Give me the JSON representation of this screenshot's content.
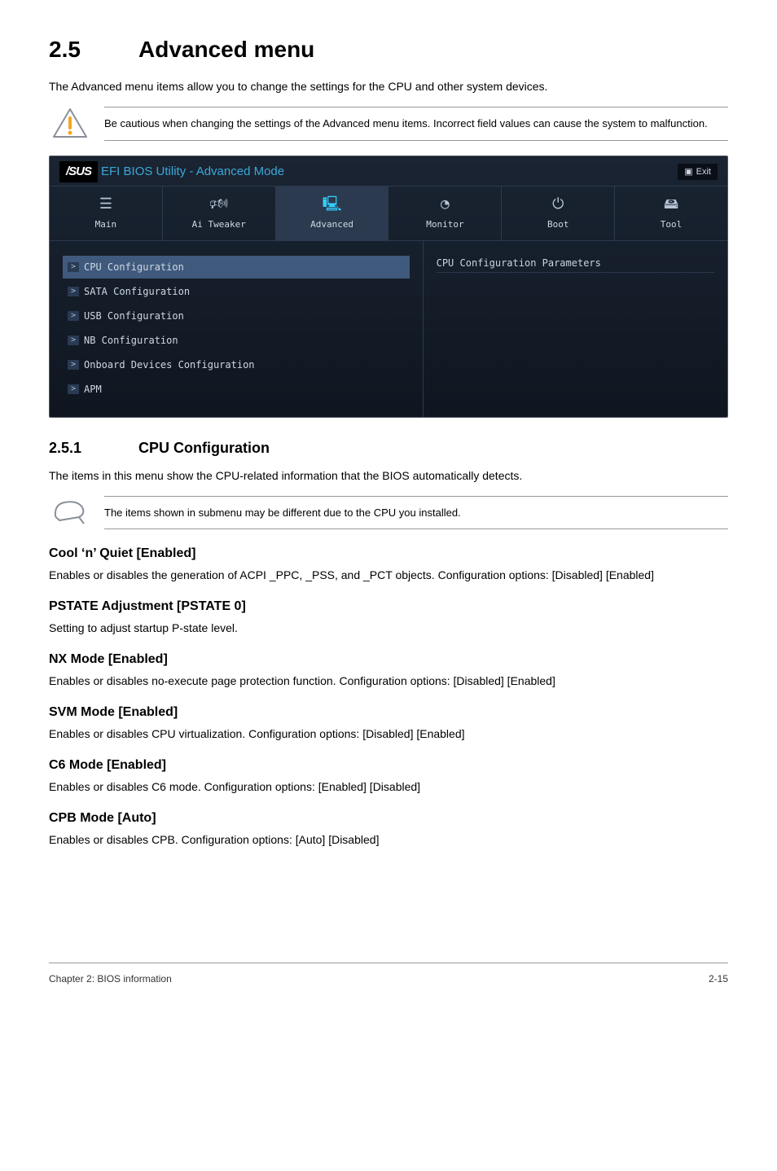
{
  "section": {
    "number": "2.5",
    "title": "Advanced menu",
    "intro": "The Advanced menu items allow you to change the settings for the CPU and other system devices."
  },
  "caution": "Be cautious when changing the settings of the Advanced menu items. Incorrect field values can cause the system to malfunction.",
  "bios": {
    "logo": "/SUS",
    "title_text": "EFI BIOS Utility - Advanced Mode",
    "exit_label": "Exit",
    "tabs": [
      {
        "label": "Main",
        "active": false,
        "icon_name": "list-icon",
        "glyph": "☰"
      },
      {
        "label": "Ai Tweaker",
        "active": false,
        "icon_name": "tweaker-icon",
        "glyph": "🕬"
      },
      {
        "label": "Advanced",
        "active": true,
        "icon_name": "chip-icon",
        "glyph": "🖳"
      },
      {
        "label": "Monitor",
        "active": false,
        "icon_name": "gauge-icon",
        "glyph": "◔"
      },
      {
        "label": "Boot",
        "active": false,
        "icon_name": "power-icon",
        "glyph": "⏻"
      },
      {
        "label": "Tool",
        "active": false,
        "icon_name": "tool-icon",
        "glyph": "🖴"
      }
    ],
    "items": [
      {
        "label": "CPU Configuration",
        "active": true
      },
      {
        "label": "SATA Configuration",
        "active": false
      },
      {
        "label": "USB Configuration",
        "active": false
      },
      {
        "label": "NB Configuration",
        "active": false
      },
      {
        "label": "Onboard Devices Configuration",
        "active": false
      },
      {
        "label": "APM",
        "active": false
      }
    ],
    "help_title": "CPU Configuration Parameters"
  },
  "subsection": {
    "number": "2.5.1",
    "title": "CPU Configuration",
    "intro": "The items in this menu show the CPU-related information that the BIOS automatically detects."
  },
  "note": "The items shown in submenu may be different due to the CPU you installed.",
  "options": [
    {
      "heading": "Cool ‘n’ Quiet [Enabled]",
      "desc": "Enables or disables the generation of ACPI _PPC, _PSS, and _PCT objects. Configuration options: [Disabled] [Enabled]"
    },
    {
      "heading": "PSTATE Adjustment [PSTATE 0]",
      "desc": "Setting to adjust startup P-state level."
    },
    {
      "heading": "NX Mode [Enabled]",
      "desc": "Enables or disables no-execute page protection function. Configuration options: [Disabled] [Enabled]"
    },
    {
      "heading": "SVM Mode [Enabled]",
      "desc": "Enables or disables CPU virtualization. Configuration options: [Disabled] [Enabled]"
    },
    {
      "heading": "C6 Mode [Enabled]",
      "desc": "Enables or disables C6 mode. Configuration options: [Enabled] [Disabled]"
    },
    {
      "heading": "CPB Mode [Auto]",
      "desc": "Enables or disables CPB. Configuration options: [Auto] [Disabled]"
    }
  ],
  "footer": {
    "left": "Chapter 2: BIOS information",
    "right": "2-15"
  }
}
